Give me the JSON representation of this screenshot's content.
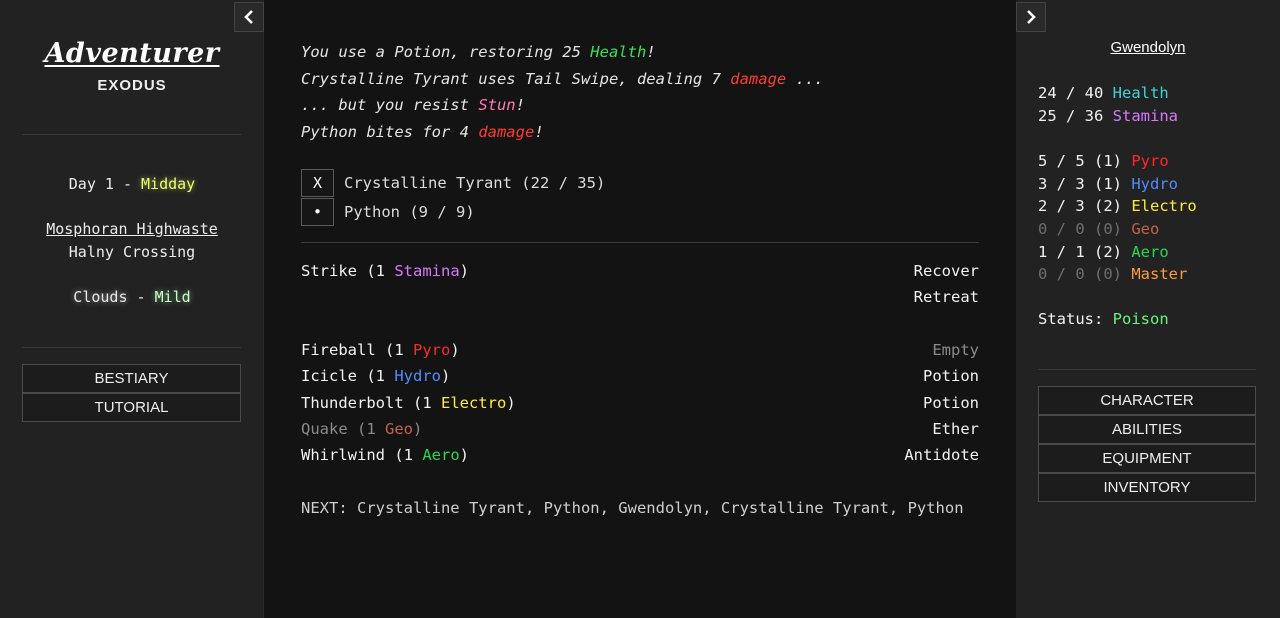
{
  "left": {
    "title": "Adventurer",
    "subtitle": "EXODUS",
    "day_prefix": "Day 1 - ",
    "day_time": "Midday",
    "region": "Mosphoran Highwaste",
    "location": "Halny Crossing",
    "weather": "Clouds",
    "weather_sep": " - ",
    "weather_intensity": "Mild",
    "buttons": {
      "bestiary": "BESTIARY",
      "tutorial": "TUTORIAL"
    }
  },
  "log": [
    {
      "pre": "You use a Potion, restoring 25 ",
      "hl": "Health",
      "post": "!"
    },
    {
      "pre": "Crystalline Tyrant uses Tail Swipe, dealing 7 ",
      "hl": "damage",
      "post": " ..."
    },
    {
      "pre": "... but you resist ",
      "hl": "Stun",
      "post": "!"
    },
    {
      "pre": "Python bites for 4 ",
      "hl": "damage",
      "post": "!"
    }
  ],
  "targets": [
    {
      "marker": "X",
      "label": "Crystalline Tyrant (22 / 35)"
    },
    {
      "marker": "•",
      "label": "Python (9 / 9)"
    }
  ],
  "actions": {
    "strike": {
      "name": "Strike",
      "open": " (1 ",
      "res": "Stamina",
      "close": ")"
    },
    "recover": "Recover",
    "retreat": "Retreat",
    "abilities": [
      {
        "name": "Fireball",
        "open": " (1 ",
        "res": "Pyro",
        "close": ")"
      },
      {
        "name": "Icicle",
        "open": " (1 ",
        "res": "Hydro",
        "close": ")"
      },
      {
        "name": "Thunderbolt",
        "open": " (1 ",
        "res": "Electro",
        "close": ")"
      },
      {
        "name": "Quake",
        "open": " (1 ",
        "res": "Geo",
        "close": ")"
      },
      {
        "name": "Whirlwind",
        "open": " (1 ",
        "res": "Aero",
        "close": ")"
      }
    ],
    "items": [
      "Empty",
      "Potion",
      "Potion",
      "Ether",
      "Antidote"
    ]
  },
  "next": "NEXT: Crystalline Tyrant, Python, Gwendolyn, Crystalline Tyrant, Python",
  "character": {
    "name": "Gwendolyn",
    "health": {
      "value": "24 / 40 ",
      "label": "Health"
    },
    "stamina": {
      "value": "25 / 36 ",
      "label": "Stamina"
    },
    "elements": [
      {
        "value": "5 / 5 (1) ",
        "label": "Pyro"
      },
      {
        "value": "3 / 3 (1) ",
        "label": "Hydro"
      },
      {
        "value": "2 / 3 (2) ",
        "label": "Electro"
      },
      {
        "value": "0 / 0 (0) ",
        "label": "Geo"
      },
      {
        "value": "1 / 1 (2) ",
        "label": "Aero"
      },
      {
        "value": "0 / 0 (0) ",
        "label": "Master"
      }
    ],
    "status_label": "Status: ",
    "status_value": "Poison",
    "menu": {
      "character": "CHARACTER",
      "abilities": "ABILITIES",
      "equipment": "EQUIPMENT",
      "inventory": "INVENTORY"
    }
  },
  "colors": {
    "health": "#35e35a",
    "damage": "#ff3b2f",
    "stun": "#ff7ab1",
    "stamina": "#d978ff",
    "pyro": "#ff2a1f",
    "hydro": "#4f8dff",
    "electro": "#ffeb3b",
    "geo": "#c0644a",
    "aero": "#2bd657",
    "master": "#ff9a3a",
    "poison": "#6df27a"
  },
  "icons": {
    "collapse_left": "chevron-left-icon",
    "collapse_right": "chevron-right-icon"
  }
}
